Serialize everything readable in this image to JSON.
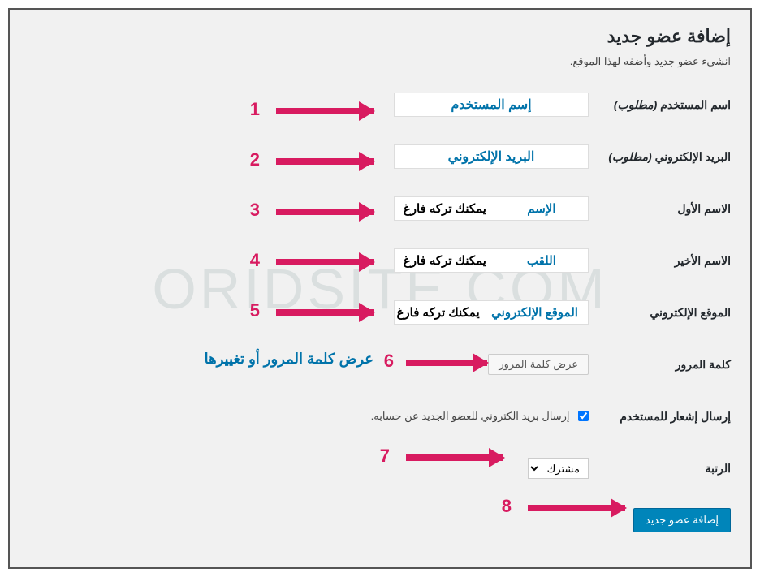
{
  "page": {
    "title": "إضافة عضو جديد",
    "description": "انشىء عضو جديد وأضفه لهذا الموقع."
  },
  "labels": {
    "username": "اسم المستخدم",
    "required": "(مطلوب)",
    "email": "البريد الإلكتروني",
    "firstname": "الاسم الأول",
    "lastname": "الاسم الأخير",
    "website": "الموقع الإلكتروني",
    "password": "كلمة المرور",
    "notification": "إرسال إشعار للمستخدم",
    "role": "الرتبة"
  },
  "fields": {
    "username_placeholder": "إسم المستخدم",
    "email_placeholder": "البريد الإلكتروني",
    "firstname_blue": "الإسم",
    "firstname_hint": "يمكنك تركه فارغ",
    "lastname_blue": "اللقب",
    "lastname_hint": "يمكنك تركه فارغ",
    "website_blue": "الموقع الإلكتروني",
    "website_hint": "يمكنك تركه فارغ",
    "password_button": "عرض كلمة المرور",
    "notification_text": "إرسال بريد الكتروني للعضو الجديد عن حسابه.",
    "role_value": "مشترك",
    "submit": "إضافة عضو جديد"
  },
  "annotations": {
    "n1": "1",
    "n2": "2",
    "n3": "3",
    "n4": "4",
    "n5": "5",
    "n6": "6",
    "n7": "7",
    "n8": "8",
    "password_note": "عرض كلمة المرور أو تغييرها"
  },
  "watermark": "ORIDSITE.COM"
}
